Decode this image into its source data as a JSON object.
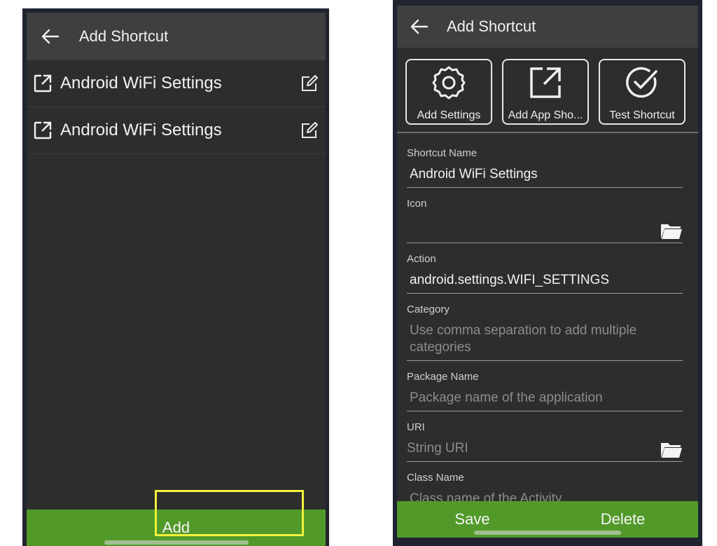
{
  "left_screen": {
    "title": "Add Shortcut",
    "items": [
      {
        "label": "Android WiFi Settings"
      },
      {
        "label": "Android WiFi Settings"
      }
    ],
    "add_label": "Add"
  },
  "right_screen": {
    "title": "Add Shortcut",
    "actions": [
      {
        "label": "Add Settings",
        "icon": "gear-icon"
      },
      {
        "label": "Add App Sho...",
        "icon": "open-external-icon"
      },
      {
        "label": "Test Shortcut",
        "icon": "check-circle-icon"
      }
    ],
    "fields": {
      "shortcut_name": {
        "label": "Shortcut Name",
        "value": "Android WiFi Settings"
      },
      "icon": {
        "label": "Icon",
        "value": ""
      },
      "action": {
        "label": "Action",
        "value": "android.settings.WIFI_SETTINGS"
      },
      "category": {
        "label": "Category",
        "placeholder": "Use comma separation to add multiple categories"
      },
      "package_name": {
        "label": "Package Name",
        "placeholder": "Package name of the application"
      },
      "uri": {
        "label": "URI",
        "placeholder": "String URI"
      },
      "class_name": {
        "label": "Class Name",
        "placeholder": "Class name of the Activity"
      }
    },
    "save_label": "Save",
    "delete_label": "Delete"
  },
  "colors": {
    "app_bar": "#3f3f3f",
    "background": "#2d2d2d",
    "accent_green": "#519a2a",
    "highlight": "#f1f13a"
  }
}
